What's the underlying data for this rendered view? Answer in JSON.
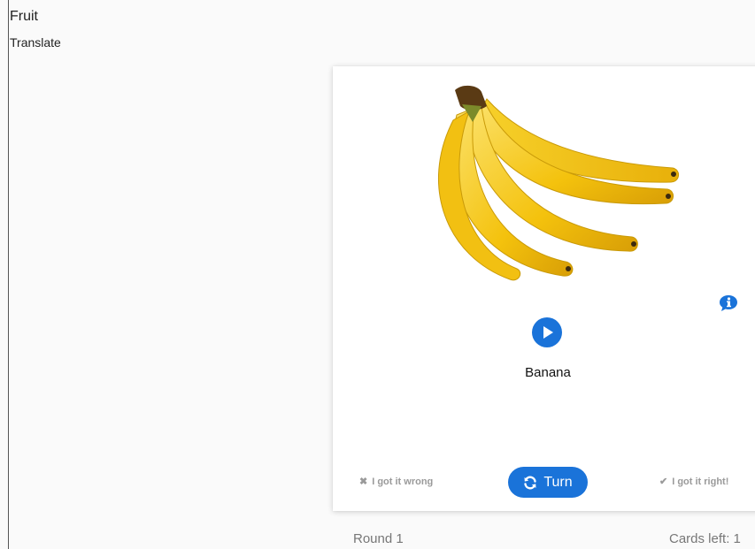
{
  "deck": {
    "title": "Fruit",
    "mode": "Translate"
  },
  "card": {
    "image_subject": "banana-bunch",
    "word": "Banana",
    "wrong_label": "I got it wrong",
    "turn_label": "Turn",
    "right_label": "I got it right!"
  },
  "footer": {
    "round": "Round 1",
    "cards_left": "Cards left: 1"
  },
  "colors": {
    "accent": "#1a73d9",
    "muted_text": "#9a9a9a",
    "banana_yellow": "#f4c20d"
  },
  "icons": [
    "info-icon",
    "play-icon",
    "refresh-icon",
    "close-icon",
    "check-icon"
  ]
}
